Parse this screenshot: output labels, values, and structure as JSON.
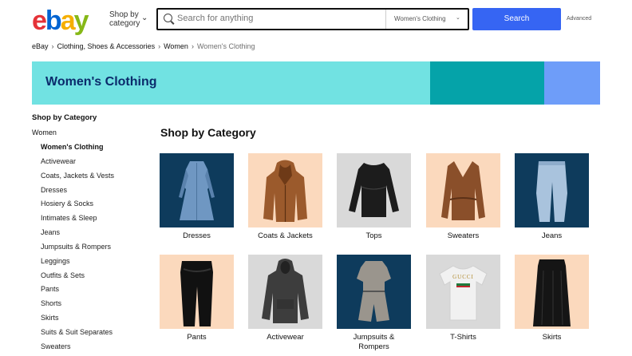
{
  "header": {
    "logo": [
      "e",
      "b",
      "a",
      "y"
    ],
    "shop_by_category": [
      "Shop by",
      "category"
    ],
    "search_placeholder": "Search for anything",
    "category_select": "Women's Clothing",
    "search_button": "Search",
    "advanced": "Advanced"
  },
  "breadcrumb": [
    "eBay",
    "Clothing, Shoes & Accessories",
    "Women",
    "Women's Clothing"
  ],
  "banner": {
    "title": "Women's Clothing",
    "colors": [
      "#71e2e2",
      "#05a3a9",
      "#6e9df9"
    ]
  },
  "sidebar": {
    "heading": "Shop by Category",
    "parent": "Women",
    "items": [
      {
        "label": "Women's Clothing",
        "active": true
      },
      {
        "label": "Activewear"
      },
      {
        "label": "Coats, Jackets & Vests"
      },
      {
        "label": "Dresses"
      },
      {
        "label": "Hosiery & Socks"
      },
      {
        "label": "Intimates & Sleep"
      },
      {
        "label": "Jeans"
      },
      {
        "label": "Jumpsuits & Rompers"
      },
      {
        "label": "Leggings"
      },
      {
        "label": "Outfits & Sets"
      },
      {
        "label": "Pants"
      },
      {
        "label": "Shorts"
      },
      {
        "label": "Skirts"
      },
      {
        "label": "Suits & Suit Separates"
      },
      {
        "label": "Sweaters"
      }
    ]
  },
  "main": {
    "title": "Shop by Category",
    "tiles": [
      {
        "label": "Dresses",
        "bg": "#0e3b5c",
        "item": "dress-icon"
      },
      {
        "label": "Coats & Jackets",
        "bg": "#fbd9bd",
        "item": "jacket-icon"
      },
      {
        "label": "Tops",
        "bg": "#d9d9d9",
        "item": "top-icon"
      },
      {
        "label": "Sweaters",
        "bg": "#fbd9bd",
        "item": "sweater-icon"
      },
      {
        "label": "Jeans",
        "bg": "#0e3b5c",
        "item": "jeans-icon"
      },
      {
        "label": "Pants",
        "bg": "#fbd9bd",
        "item": "pants-icon"
      },
      {
        "label": "Activewear",
        "bg": "#d9d9d9",
        "item": "hoodie-icon"
      },
      {
        "label": "Jumpsuits & Rompers",
        "bg": "#0e3b5c",
        "item": "romper-icon"
      },
      {
        "label": "T-Shirts",
        "bg": "#d9d9d9",
        "item": "tshirt-icon",
        "print": "GUCCI"
      },
      {
        "label": "Skirts",
        "bg": "#fbd9bd",
        "item": "skirt-icon"
      }
    ]
  }
}
